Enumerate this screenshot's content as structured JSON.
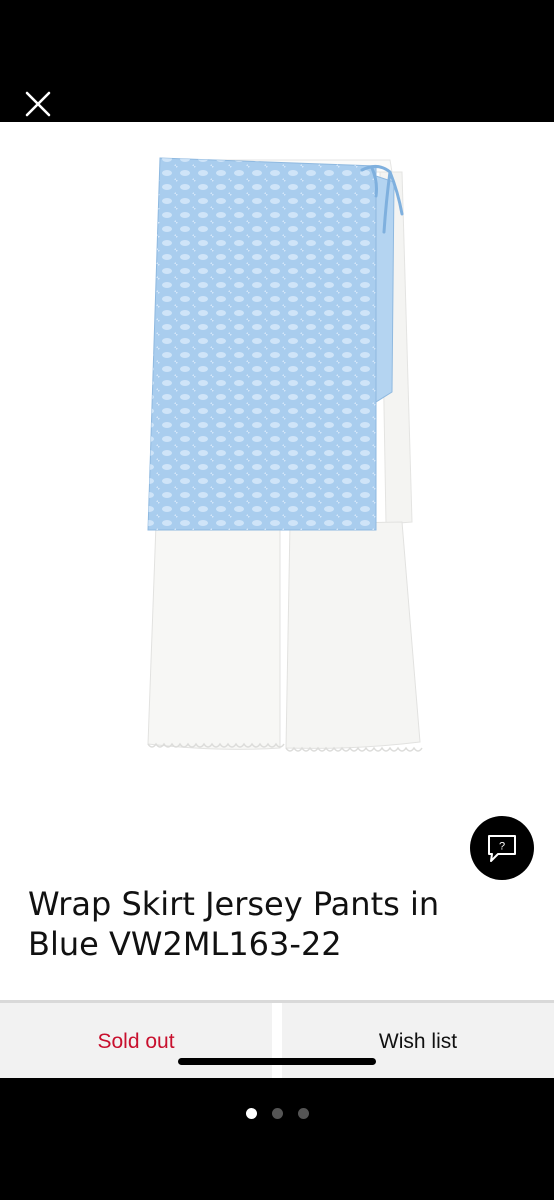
{
  "product": {
    "title_line1": "Wrap Skirt Jersey Pants in",
    "title_line2": "Blue VW2ML163-22"
  },
  "actions": {
    "sold_out_label": "Sold out",
    "wish_list_label": "Wish list"
  },
  "chat": {
    "glyph": "?"
  },
  "pager": {
    "pages": 3,
    "active_page": 1
  },
  "colors": {
    "skirt": "#a9cdee",
    "pants": "#f7f7f5",
    "sold_out": "#c8102e",
    "background_dark": "#000000"
  },
  "icons": [
    "close-icon",
    "chat-help-icon"
  ]
}
